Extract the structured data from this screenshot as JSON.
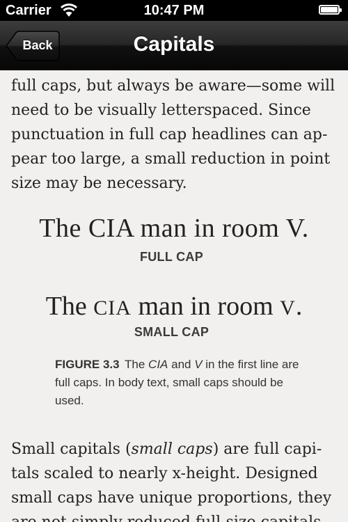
{
  "status_bar": {
    "carrier": "Carrier",
    "time": "10:47 PM",
    "wifi_icon": "wifi-icon",
    "battery_icon": "battery-icon"
  },
  "nav": {
    "back_label": "Back",
    "title": "Capitals"
  },
  "content": {
    "para_top": "full caps, but always be aware—some will\nneed to be visually letterspaced. Since\npunctuation in full cap headlines can ap-\npear too large, a small reduction in point\nsize may be necessary.",
    "sample_full": "The CIA man in room V.",
    "label_full": "FULL CAP",
    "sample_small_a": "The ",
    "sample_small_b": "cia",
    "sample_small_c": " man in room ",
    "sample_small_d": "v",
    "sample_small_e": ".",
    "label_small": "SMALL CAP",
    "caption": {
      "number": "FIGURE 3.3",
      "t1": "The ",
      "e1": "CIA",
      "t2": " and ",
      "e2": "V",
      "t3": " in the first line are full caps. In body text, small caps should be used."
    },
    "para_bottom_1": "Small capitals (",
    "para_bottom_em": "small caps",
    "para_bottom_2": ") are full capi-\ntals scaled to nearly x-height. Designed\nsmall caps have unique proportions, they\nare not simply reduced full-size capitals"
  },
  "colors": {
    "background": "#f1f0ee",
    "nav_dark": "#111111",
    "text": "#222222"
  }
}
